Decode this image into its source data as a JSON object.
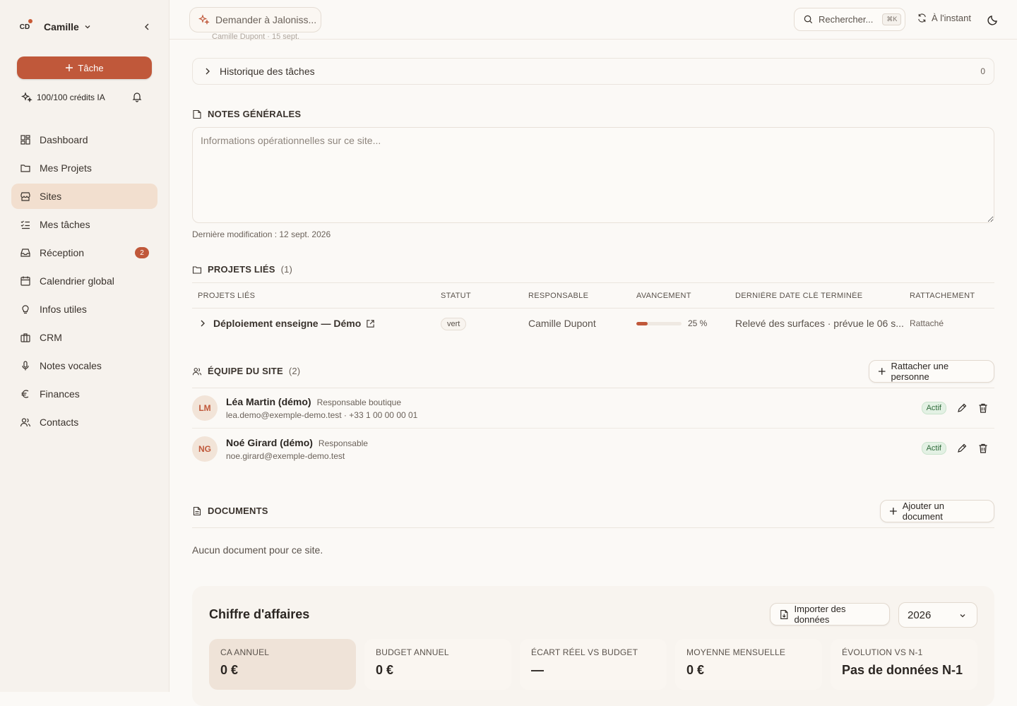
{
  "sidebar": {
    "user_initials": "CD",
    "user_name": "Camille",
    "task_button": "Tâche",
    "credits": "100/100 crédits IA",
    "items": [
      {
        "label": "Dashboard"
      },
      {
        "label": "Mes Projets"
      },
      {
        "label": "Sites",
        "active": true
      },
      {
        "label": "Mes tâches"
      },
      {
        "label": "Réception",
        "badge": "2"
      },
      {
        "label": "Calendrier global"
      },
      {
        "label": "Infos utiles"
      },
      {
        "label": "CRM"
      },
      {
        "label": "Notes vocales"
      },
      {
        "label": "Finances"
      },
      {
        "label": "Contacts"
      }
    ]
  },
  "topbar": {
    "ask_label": "Demander à Jaloniss...",
    "search_label": "Rechercher...",
    "search_shortcut": "⌘K",
    "sync_label": "À l'instant"
  },
  "peek": {
    "text": "Camille Dupont · 15 sept."
  },
  "history": {
    "label": "Historique des tâches",
    "count": "0"
  },
  "notes": {
    "title": "NOTES GÉNÉRALES",
    "placeholder": "Informations opérationnelles sur ce site...",
    "last_modified": "Dernière modification : 12 sept. 2026"
  },
  "projects": {
    "title": "PROJETS LIÉS",
    "count": "(1)",
    "columns": [
      "PROJETS LIÉS",
      "STATUT",
      "RESPONSABLE",
      "AVANCEMENT",
      "DERNIÈRE DATE CLÉ TERMINÉE",
      "RATTACHEMENT"
    ],
    "rows": [
      {
        "name": "Déploiement enseigne — Démo",
        "status": "vert",
        "owner": "Camille Dupont",
        "progress": 25,
        "progress_label": "25 %",
        "last_milestone": "Relevé des surfaces · prévue le 06 s...",
        "attachment": "Rattaché"
      }
    ]
  },
  "team": {
    "title": "ÉQUIPE DU SITE",
    "count": "(2)",
    "add_button": "Rattacher une personne",
    "members": [
      {
        "initials": "LM",
        "name": "Léa Martin (démo)",
        "role": "Responsable boutique",
        "contact": "lea.demo@exemple-demo.test · +33 1 00 00 00 01",
        "status": "Actif"
      },
      {
        "initials": "NG",
        "name": "Noé Girard (démo)",
        "role": "Responsable",
        "contact": "noe.girard@exemple-demo.test",
        "status": "Actif"
      }
    ]
  },
  "documents": {
    "title": "DOCUMENTS",
    "add_button": "Ajouter un document",
    "empty": "Aucun document pour ce site."
  },
  "revenue": {
    "title": "Chiffre d'affaires",
    "import_button": "Importer des données",
    "year": "2026",
    "kpis": [
      {
        "label": "CA ANNUEL",
        "value": "0 €"
      },
      {
        "label": "BUDGET ANNUEL",
        "value": "0 €"
      },
      {
        "label": "ÉCART RÉEL VS BUDGET",
        "value": "—"
      },
      {
        "label": "MOYENNE MENSUELLE",
        "value": "0 €"
      },
      {
        "label": "ÉVOLUTION VS N-1",
        "value": "Pas de données N-1"
      }
    ]
  },
  "colors": {
    "accent": "#c0583a",
    "sidebar_bg": "#f6f2ed",
    "active_nav": "#f2dfcf",
    "success": "#2f6b3a"
  }
}
